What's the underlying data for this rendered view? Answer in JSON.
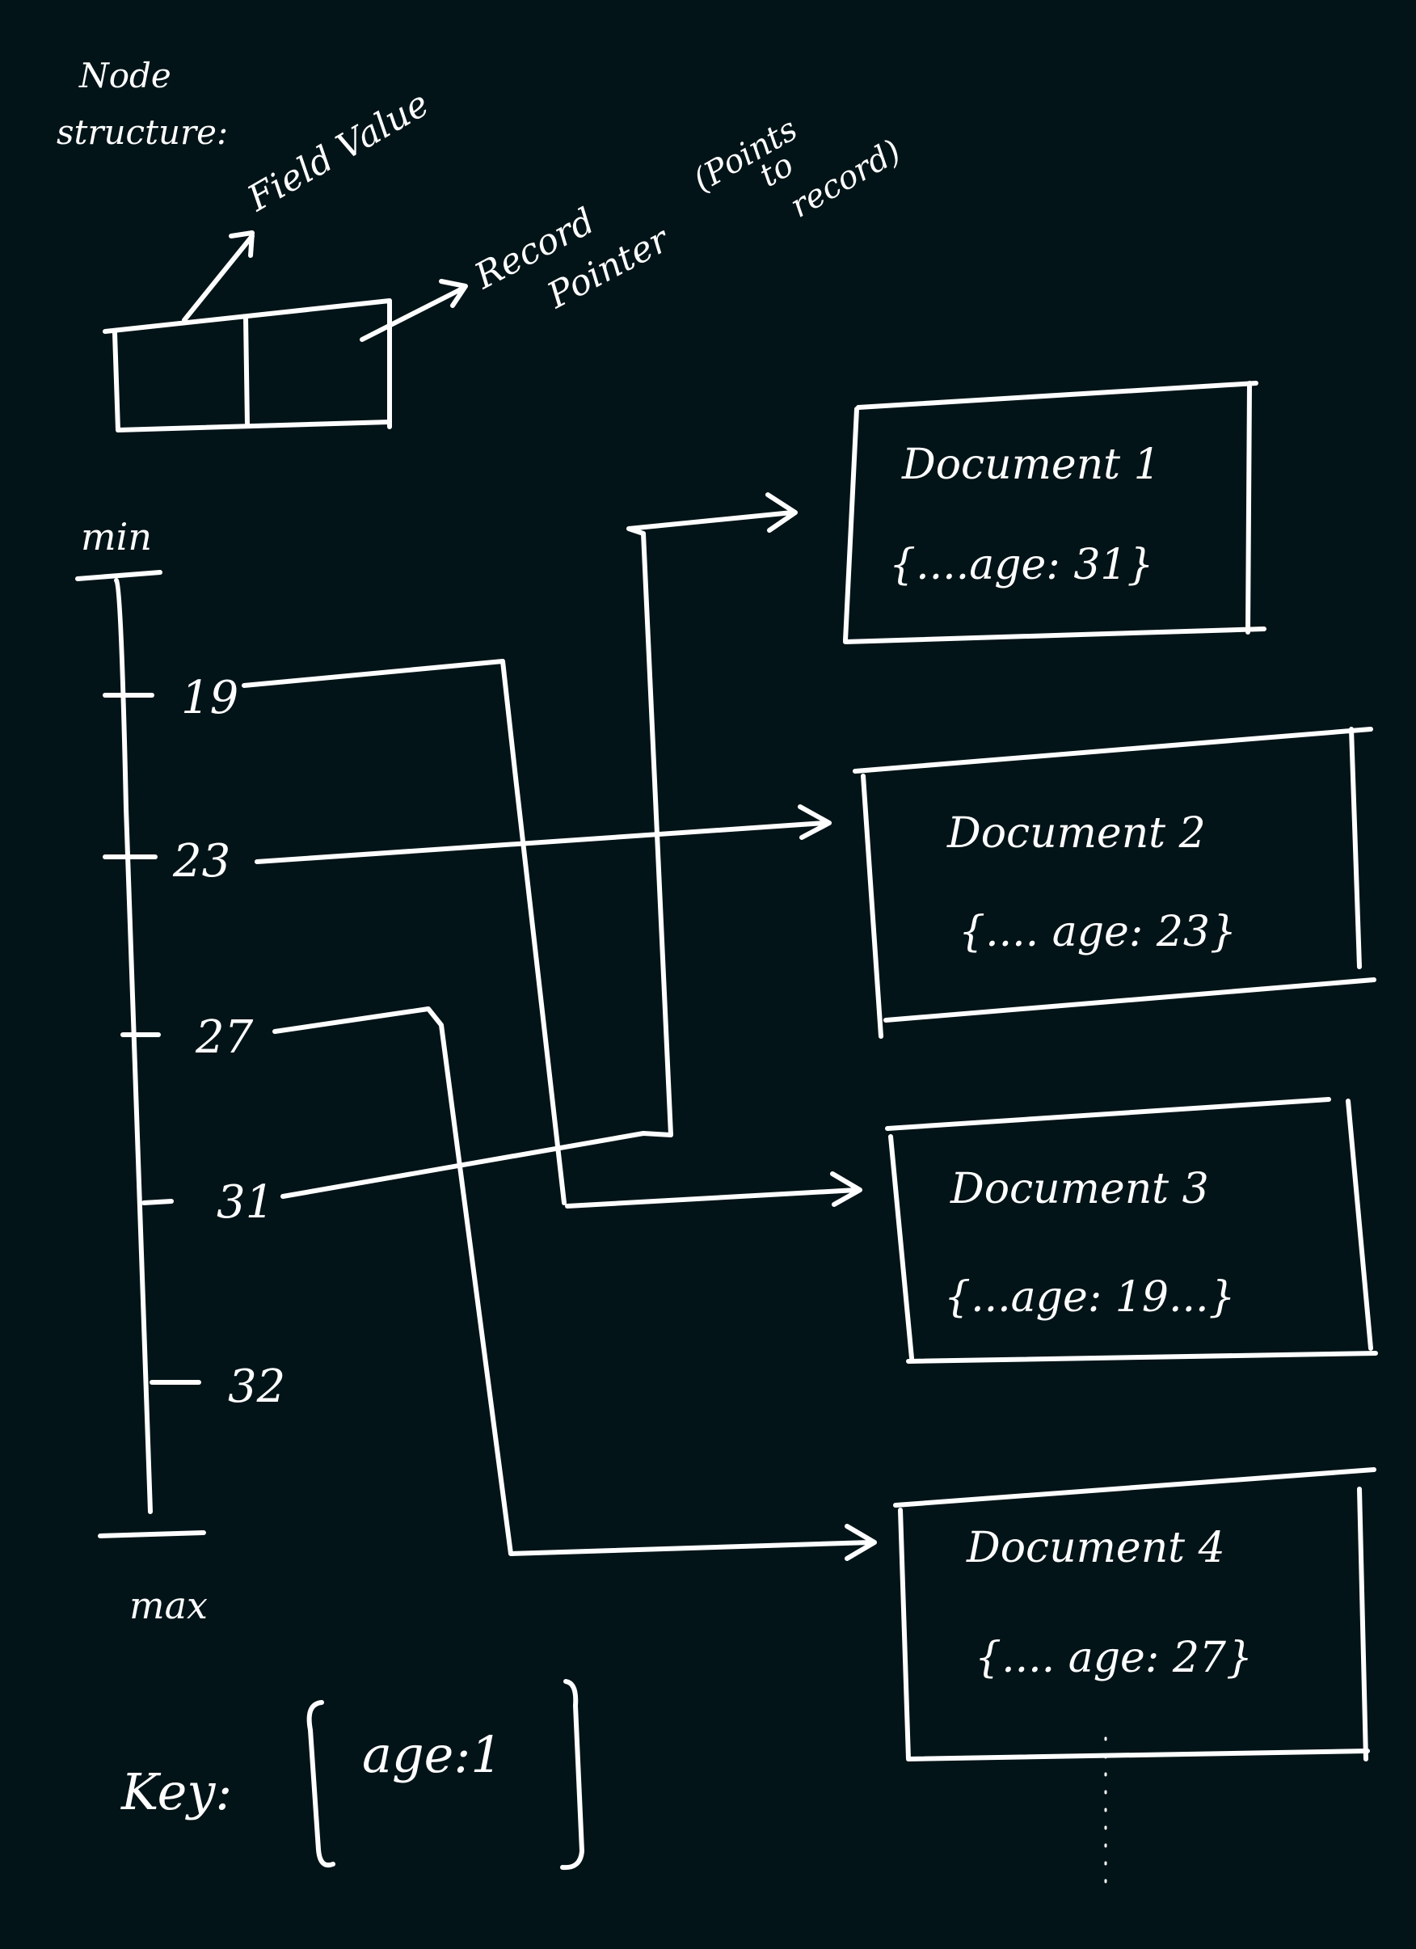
{
  "node_structure": {
    "title_line1": "Node",
    "title_line2": "structure:",
    "field_value_label": "Field Value",
    "record_pointer_line1": "Record",
    "record_pointer_line2": "Pointer",
    "points_to_line1": "(Points",
    "points_to_line2": "to",
    "points_to_line3": "record)"
  },
  "index": {
    "min_label": "min",
    "max_label": "max",
    "keys": [
      {
        "value": "19",
        "points_to": "Document 3"
      },
      {
        "value": "23",
        "points_to": "Document 2"
      },
      {
        "value": "27",
        "points_to": "Document 4"
      },
      {
        "value": "31",
        "points_to": "Document 1"
      },
      {
        "value": "32"
      }
    ]
  },
  "documents": [
    {
      "title": "Document 1",
      "content": "{....age: 31}"
    },
    {
      "title": "Document 2",
      "content": "{.... age: 23}"
    },
    {
      "title": "Document 3",
      "content": "{...age: 19...}"
    },
    {
      "title": "Document 4",
      "content": "{.... age: 27}"
    }
  ],
  "key_spec": {
    "label": "Key:",
    "value": "age:1"
  },
  "colors": {
    "background": "#031418",
    "ink": "#ffffff"
  }
}
